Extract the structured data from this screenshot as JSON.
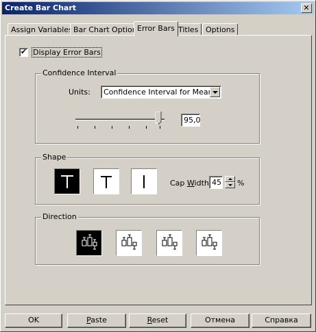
{
  "window": {
    "title": "Create Bar Chart",
    "close_glyph": "✕"
  },
  "tabs": [
    {
      "label": "Assign Variables"
    },
    {
      "label": "Bar Chart Options"
    },
    {
      "label": "Error Bars"
    },
    {
      "label": "Titles"
    },
    {
      "label": "Options"
    }
  ],
  "display_error_bars": {
    "label": "Display Error Bars",
    "checked": true,
    "check_glyph": "✔"
  },
  "confidence": {
    "group_label": "Confidence Interval",
    "units_label": "Units:",
    "units_value": "Confidence Interval for Mean",
    "slider_value": "95,0",
    "slider_fraction": 0.93
  },
  "shape": {
    "group_label": "Shape",
    "options": [
      "cap-full",
      "cap-short",
      "line-only"
    ],
    "selected": 0,
    "cap_width_label_pre": "Cap ",
    "cap_width_label_ul": "W",
    "cap_width_label_post": "idth:",
    "cap_width_value": "45",
    "cap_width_unit": "%"
  },
  "direction": {
    "group_label": "Direction",
    "options": [
      "both",
      "up",
      "down",
      "alternate"
    ],
    "selected": 0
  },
  "buttons": {
    "ok": "OK",
    "paste_ul": "P",
    "paste_rest": "aste",
    "reset_ul": "R",
    "reset_rest": "eset",
    "cancel": "Отмена",
    "help": "Справка"
  }
}
